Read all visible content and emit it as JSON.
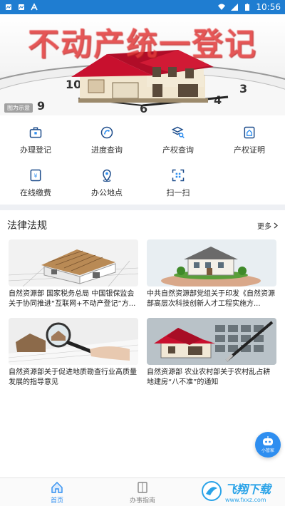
{
  "status_bar": {
    "time": "10:56",
    "icons": [
      "notification-icon",
      "notification-icon",
      "letter-a-icon",
      "wifi-icon",
      "signal-icon",
      "battery-icon"
    ]
  },
  "banner": {
    "title": "不动产统一登记",
    "caption": "图为示意"
  },
  "quick_menu": [
    {
      "label": "办理登记",
      "icon": "briefcase-icon"
    },
    {
      "label": "进度查询",
      "icon": "progress-icon"
    },
    {
      "label": "产权查询",
      "icon": "layers-search-icon"
    },
    {
      "label": "产权证明",
      "icon": "certificate-house-icon"
    },
    {
      "label": "在线缴费",
      "icon": "payment-icon"
    },
    {
      "label": "办公地点",
      "icon": "location-pin-icon"
    },
    {
      "label": "扫一扫",
      "icon": "qr-scan-icon"
    }
  ],
  "news_section": {
    "title": "法律法规",
    "more_label": "更多"
  },
  "news": [
    {
      "text": "自然资源部 国家税务总局 中国银保监会关于协同推进“互联网+不动产登记”方..."
    },
    {
      "text": "中共自然资源部党组关于印发《自然资源部高层次科技创新人才工程实施方..."
    },
    {
      "text": "自然资源部关于促进地质勘查行业高质量发展的指导意见"
    },
    {
      "text": "自然资源部 农业农村部关于农村乱占耕地建房“八不准”的通知"
    }
  ],
  "assistant": {
    "label": "小管家"
  },
  "bottom_nav": [
    {
      "label": "首页",
      "active": true
    },
    {
      "label": "办事指南",
      "active": false
    }
  ],
  "watermark": {
    "main": "飞翔下载",
    "sub": "www.fxxz.com"
  },
  "colors": {
    "primary": "#1f7dd1",
    "accent": "#2e8ef0",
    "banner_red": "#e23a3a"
  }
}
